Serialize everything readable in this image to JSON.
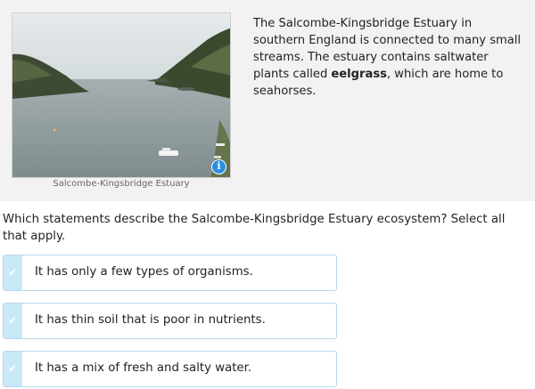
{
  "passage": {
    "image_caption": "Salcombe-Kingsbridge Estuary",
    "text_part1": "The Salcombe-Kingsbridge Estuary in southern England is connected to many small streams. The estuary contains saltwater plants called ",
    "text_bold": "eelgrass",
    "text_part2": ", which are home to seahorses.",
    "info_icon": "i"
  },
  "question": {
    "prompt": "Which statements describe the Salcombe-Kingsbridge Estuary ecosystem? Select all that apply."
  },
  "choices": [
    {
      "label": "It has only a few types of organisms.",
      "check": "✔"
    },
    {
      "label": "It has thin soil that is poor in nutrients.",
      "check": "✔"
    },
    {
      "label": "It has a mix of fresh and salty water.",
      "check": "✔"
    }
  ]
}
